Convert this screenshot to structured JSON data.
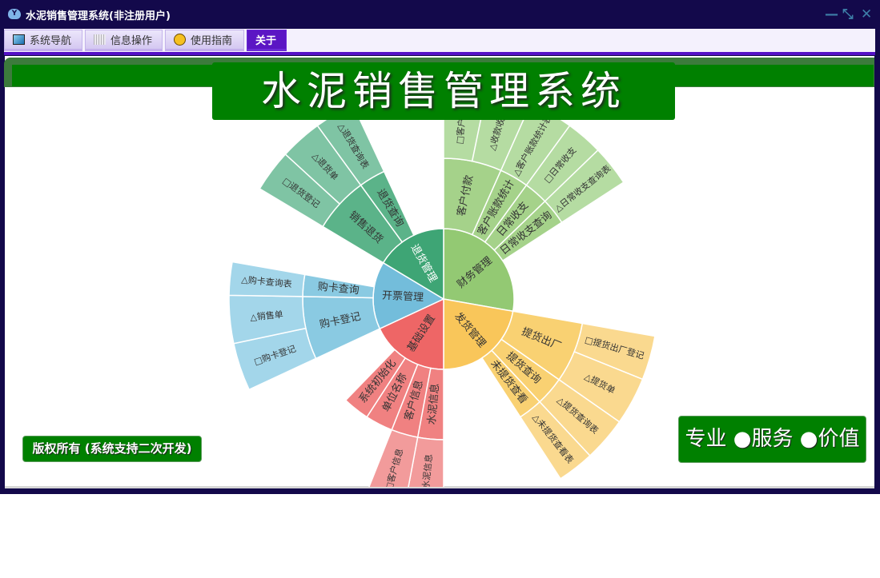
{
  "window": {
    "title": "水泥销售管理系统(非注册用户)",
    "controls": {
      "minimize": "—",
      "restore": "⤡",
      "close": "✕"
    }
  },
  "tabs": [
    {
      "label": "系统导航",
      "icon": "monitor-icon"
    },
    {
      "label": "信息操作",
      "icon": "grid-icon"
    },
    {
      "label": "使用指南",
      "icon": "help-icon"
    },
    {
      "label": "关于",
      "active": true
    }
  ],
  "banner": {
    "title": "水泥销售管理系统"
  },
  "footer": {
    "copyright": "版权所有 (系统支持二次开发)",
    "slogan": "专业 ●服务 ●价值"
  },
  "chart_data": {
    "type": "sunburst",
    "children": [
      {
        "name": "财务管理",
        "value": 100,
        "colors": [
          "#93c973",
          "#a5d28a",
          "#b5dca2"
        ],
        "children": [
          {
            "name": "客户付款",
            "value": 24,
            "children": [
              {
                "name": "□客户付款",
                "value": 11.7
              },
              {
                "name": "△收款收据",
                "value": 12.3
              }
            ]
          },
          {
            "name": "客户账款统计",
            "value": 12,
            "children": [
              {
                "name": "△客户账款统计表",
                "value": 12
              }
            ]
          },
          {
            "name": "日常收支",
            "value": 10,
            "children": [
              {
                "name": "□日常收支",
                "value": 10
              }
            ]
          },
          {
            "name": "日常收支查询",
            "value": 11,
            "children": [
              {
                "name": "△日常收支查询表",
                "value": 11
              }
            ]
          }
        ]
      },
      {
        "name": "发货管理",
        "value": 80,
        "colors": [
          "#f9c65a",
          "#f9d172",
          "#fad98f"
        ],
        "children": [
          {
            "name": "提货出厂",
            "value": 25,
            "children": [
              {
                "name": "□提货出厂登记",
                "value": 12
              },
              {
                "name": "△提货单",
                "value": 13
              }
            ]
          },
          {
            "name": "提货查询",
            "value": 12,
            "children": [
              {
                "name": "△提货查询表",
                "value": 12
              }
            ]
          },
          {
            "name": "未提货查看",
            "value": 10,
            "children": [
              {
                "name": "△未提货查看表",
                "value": 10
              }
            ]
          }
        ]
      },
      {
        "name": "基础设置",
        "value": 65,
        "colors": [
          "#ee6666",
          "#f08181",
          "#f29b9b"
        ],
        "children": [
          {
            "name": "水泥信息",
            "value": 10.6,
            "children": [
              {
                "name": "□水泥信息",
                "value": 10.6
              }
            ]
          },
          {
            "name": "客户信息",
            "value": 11,
            "children": [
              {
                "name": "□客户信息",
                "value": 11
              }
            ]
          },
          {
            "name": "单位名称",
            "value": 11.4,
            "children": []
          },
          {
            "name": "系统初始化",
            "value": 11,
            "children": []
          }
        ]
      },
      {
        "name": "开票管理",
        "value": 56,
        "colors": [
          "#73bddb",
          "#8acae2",
          "#a3d6ea"
        ],
        "children": [
          {
            "name": "购卡登记",
            "value": 26,
            "children": [
              {
                "name": "□购卡登记",
                "value": 13
              },
              {
                "name": "△销售单",
                "value": 13
              }
            ]
          },
          {
            "name": "购卡查询",
            "value": 9,
            "children": [
              {
                "name": "△购卡查询表",
                "value": 9
              }
            ]
          }
        ]
      },
      {
        "name": "退货管理",
        "value": 59,
        "colors": [
          "#3ea575",
          "#5bb389",
          "#7fc4a4"
        ],
        "children": [
          {
            "name": "销售退货",
            "value": 23,
            "children": [
              {
                "name": "□退货登记",
                "value": 11.5
              },
              {
                "name": "△退货单",
                "value": 11.5
              }
            ]
          },
          {
            "name": "退货查询",
            "value": 11,
            "children": [
              {
                "name": "△退货查询表",
                "value": 11
              }
            ]
          }
        ]
      }
    ]
  }
}
